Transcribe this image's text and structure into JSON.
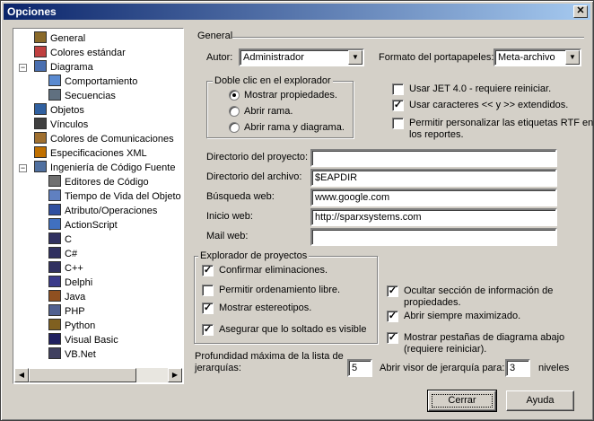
{
  "window": {
    "title": "Opciones",
    "close_glyph": "✕"
  },
  "tree": {
    "items": [
      {
        "label": "General",
        "icon": "general-icon",
        "level": 0
      },
      {
        "label": "Colores estándar",
        "icon": "palette-icon",
        "level": 0
      },
      {
        "label": "Diagrama",
        "icon": "diagram-icon",
        "level": 0,
        "expander": "−"
      },
      {
        "label": "Comportamiento",
        "icon": "behavior-icon",
        "level": 1
      },
      {
        "label": "Secuencias",
        "icon": "sequence-icon",
        "level": 1
      },
      {
        "label": "Objetos",
        "icon": "objects-icon",
        "level": 0
      },
      {
        "label": "Vínculos",
        "icon": "links-icon",
        "level": 0
      },
      {
        "label": "Colores de Comunicaciones",
        "icon": "communications-icon",
        "level": 0
      },
      {
        "label": "Especificaciones XML",
        "icon": "xml-icon",
        "level": 0
      },
      {
        "label": "Ingeniería de Código Fuente",
        "icon": "source-code-icon",
        "level": 0,
        "expander": "−"
      },
      {
        "label": "Editores de Código",
        "icon": "code-editor-icon",
        "level": 1
      },
      {
        "label": "Tiempo de Vida del Objeto",
        "icon": "object-lifetime-icon",
        "level": 1
      },
      {
        "label": "Atributo/Operaciones",
        "icon": "attribute-icon",
        "level": 1
      },
      {
        "label": "ActionScript",
        "icon": "actionscript-icon",
        "level": 1
      },
      {
        "label": "C",
        "icon": "c-icon",
        "level": 1
      },
      {
        "label": "C#",
        "icon": "csharp-icon",
        "level": 1
      },
      {
        "label": "C++",
        "icon": "cpp-icon",
        "level": 1
      },
      {
        "label": "Delphi",
        "icon": "delphi-icon",
        "level": 1
      },
      {
        "label": "Java",
        "icon": "java-icon",
        "level": 1
      },
      {
        "label": "PHP",
        "icon": "php-icon",
        "level": 1
      },
      {
        "label": "Python",
        "icon": "python-icon",
        "level": 1
      },
      {
        "label": "Visual Basic",
        "icon": "visual-basic-icon",
        "level": 1
      },
      {
        "label": "VB.Net",
        "icon": "vbnet-icon",
        "level": 1
      }
    ],
    "scroll_left": "◀",
    "scroll_right": "▶"
  },
  "general": {
    "section_title": "General",
    "author_label": "Autor:",
    "author_value": "Administrador",
    "clipboard_label": "Formato del portapapeles:",
    "clipboard_value": "Meta-archivo",
    "combo_arrow": "▼",
    "double_click_group": "Doble clic en el explorador",
    "radios": [
      {
        "label": "Mostrar propiedades.",
        "selected": true
      },
      {
        "label": "Abrir rama.",
        "selected": false
      },
      {
        "label": "Abrir rama y diagrama.",
        "selected": false
      }
    ],
    "right_checks": [
      {
        "label": "Usar JET 4.0 - requiere reiniciar.",
        "checked": false
      },
      {
        "label": "Usar caracteres << y >> extendidos.",
        "checked": true
      },
      {
        "label": "Permitir personalizar las etiquetas RTF en",
        "label2": "los reportes.",
        "checked": false
      }
    ],
    "check_glyph": "✓",
    "fields": [
      {
        "label": "Directorio del proyecto:",
        "value": ""
      },
      {
        "label": "Directorio del archivo:",
        "value": "$EAPDIR"
      },
      {
        "label": "Búsqueda web:",
        "value": "www.google.com"
      },
      {
        "label": "Inicio web:",
        "value": "http://sparxsystems.com"
      },
      {
        "label": "Mail web:",
        "value": ""
      }
    ],
    "project_explorer_group": "Explorador de proyectos",
    "explorer_checks": [
      {
        "label": "Confirmar eliminaciones.",
        "checked": true
      },
      {
        "label": "Permitir ordenamiento libre.",
        "checked": false
      },
      {
        "label": "Mostrar estereotipos.",
        "checked": true
      },
      {
        "label": "Asegurar que lo soltado es visible",
        "checked": true
      }
    ],
    "bottom_right_checks": [
      {
        "label": "Ocultar sección de información de",
        "label2": "propiedades.",
        "checked": true
      },
      {
        "label": "Abrir siempre maximizado.",
        "checked": true
      },
      {
        "label": "Mostrar pestañas de diagrama abajo",
        "label2": "(requiere reiniciar).",
        "checked": true
      }
    ],
    "depth_label_line1": "Profundidad máxima de la lista de",
    "depth_label_line2": "jerarquías:",
    "depth_value": "5",
    "hierarchy_viewer_label": "Abrir visor de jerarquía para:",
    "hierarchy_viewer_value": "3",
    "levels_label": "niveles"
  },
  "buttons": {
    "close": "Cerrar",
    "help": "Ayuda"
  }
}
